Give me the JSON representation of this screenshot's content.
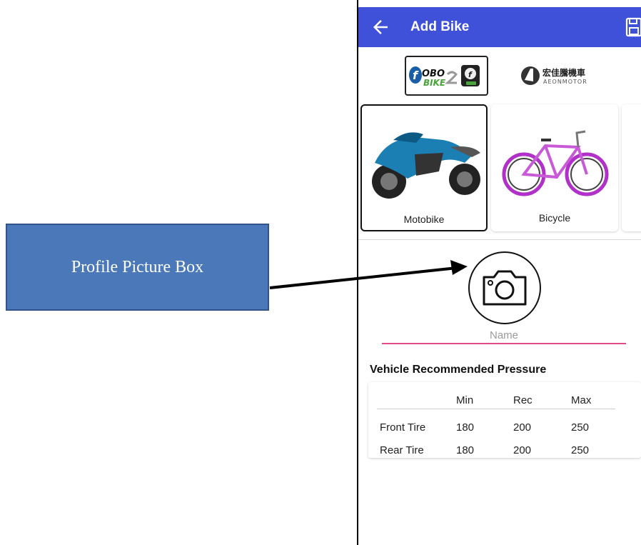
{
  "appbar": {
    "title": "Add Bike",
    "back_icon": "arrow-left-icon",
    "save_icon": "save-icon",
    "color": "#3f51d9"
  },
  "brands": [
    {
      "name": "FOBO BIKE 2",
      "selected": true,
      "logo": "fobo-bike2-logo"
    },
    {
      "name": "宏佳騰機車 AEONMOTOR",
      "selected": false,
      "logo": "aeonmotor-logo"
    }
  ],
  "vehicle_types": [
    {
      "label": "Motobike",
      "selected": true,
      "image": "motorbike-image"
    },
    {
      "label": "Bicycle",
      "selected": false,
      "image": "bicycle-image"
    }
  ],
  "profile": {
    "icon": "camera-icon"
  },
  "name_field": {
    "placeholder": "Name",
    "value": "",
    "accent": "#e04a86"
  },
  "pressure": {
    "title": "Vehicle Recommended Pressure",
    "columns": [
      "",
      "Min",
      "Rec",
      "Max"
    ],
    "rows": [
      {
        "label": "Front Tire",
        "min": "180",
        "rec": "200",
        "max": "250"
      },
      {
        "label": "Rear Tire",
        "min": "180",
        "rec": "200",
        "max": "250"
      }
    ]
  },
  "annotation": {
    "text": "Profile Picture Box",
    "color": "#4a78b8"
  }
}
